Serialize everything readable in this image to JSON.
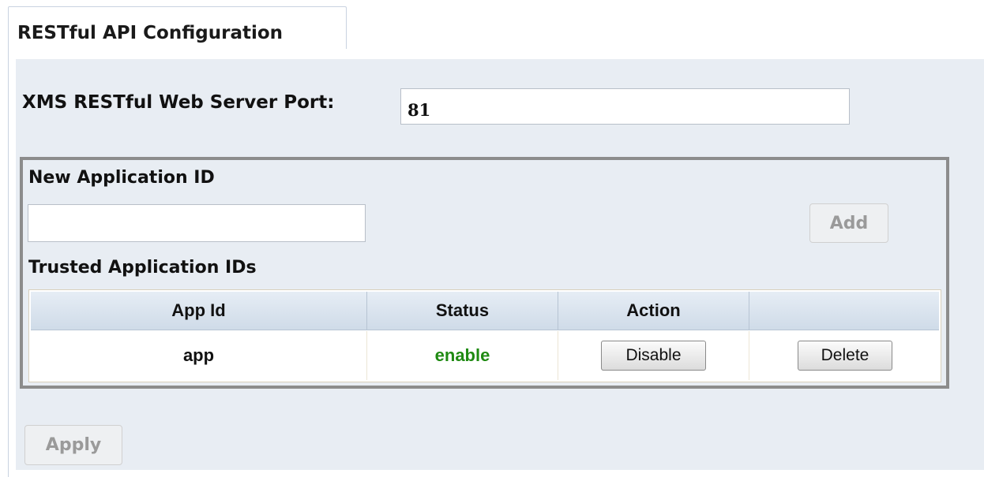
{
  "tab": {
    "title": "RESTful API Configuration"
  },
  "server": {
    "port_label": "XMS RESTful Web Server Port:",
    "port_value": "81"
  },
  "new_app": {
    "label": "New Application ID",
    "value": "",
    "add_label": "Add"
  },
  "trusted": {
    "label": "Trusted Application IDs",
    "columns": [
      "App Id",
      "Status",
      "Action",
      ""
    ],
    "rows": [
      {
        "app_id": "app",
        "status": "enable",
        "action_label": "Disable",
        "delete_label": "Delete"
      }
    ]
  },
  "footer": {
    "apply_label": "Apply"
  },
  "colors": {
    "status_enable": "#1f8a12",
    "panel_bg": "#e8edf3"
  }
}
